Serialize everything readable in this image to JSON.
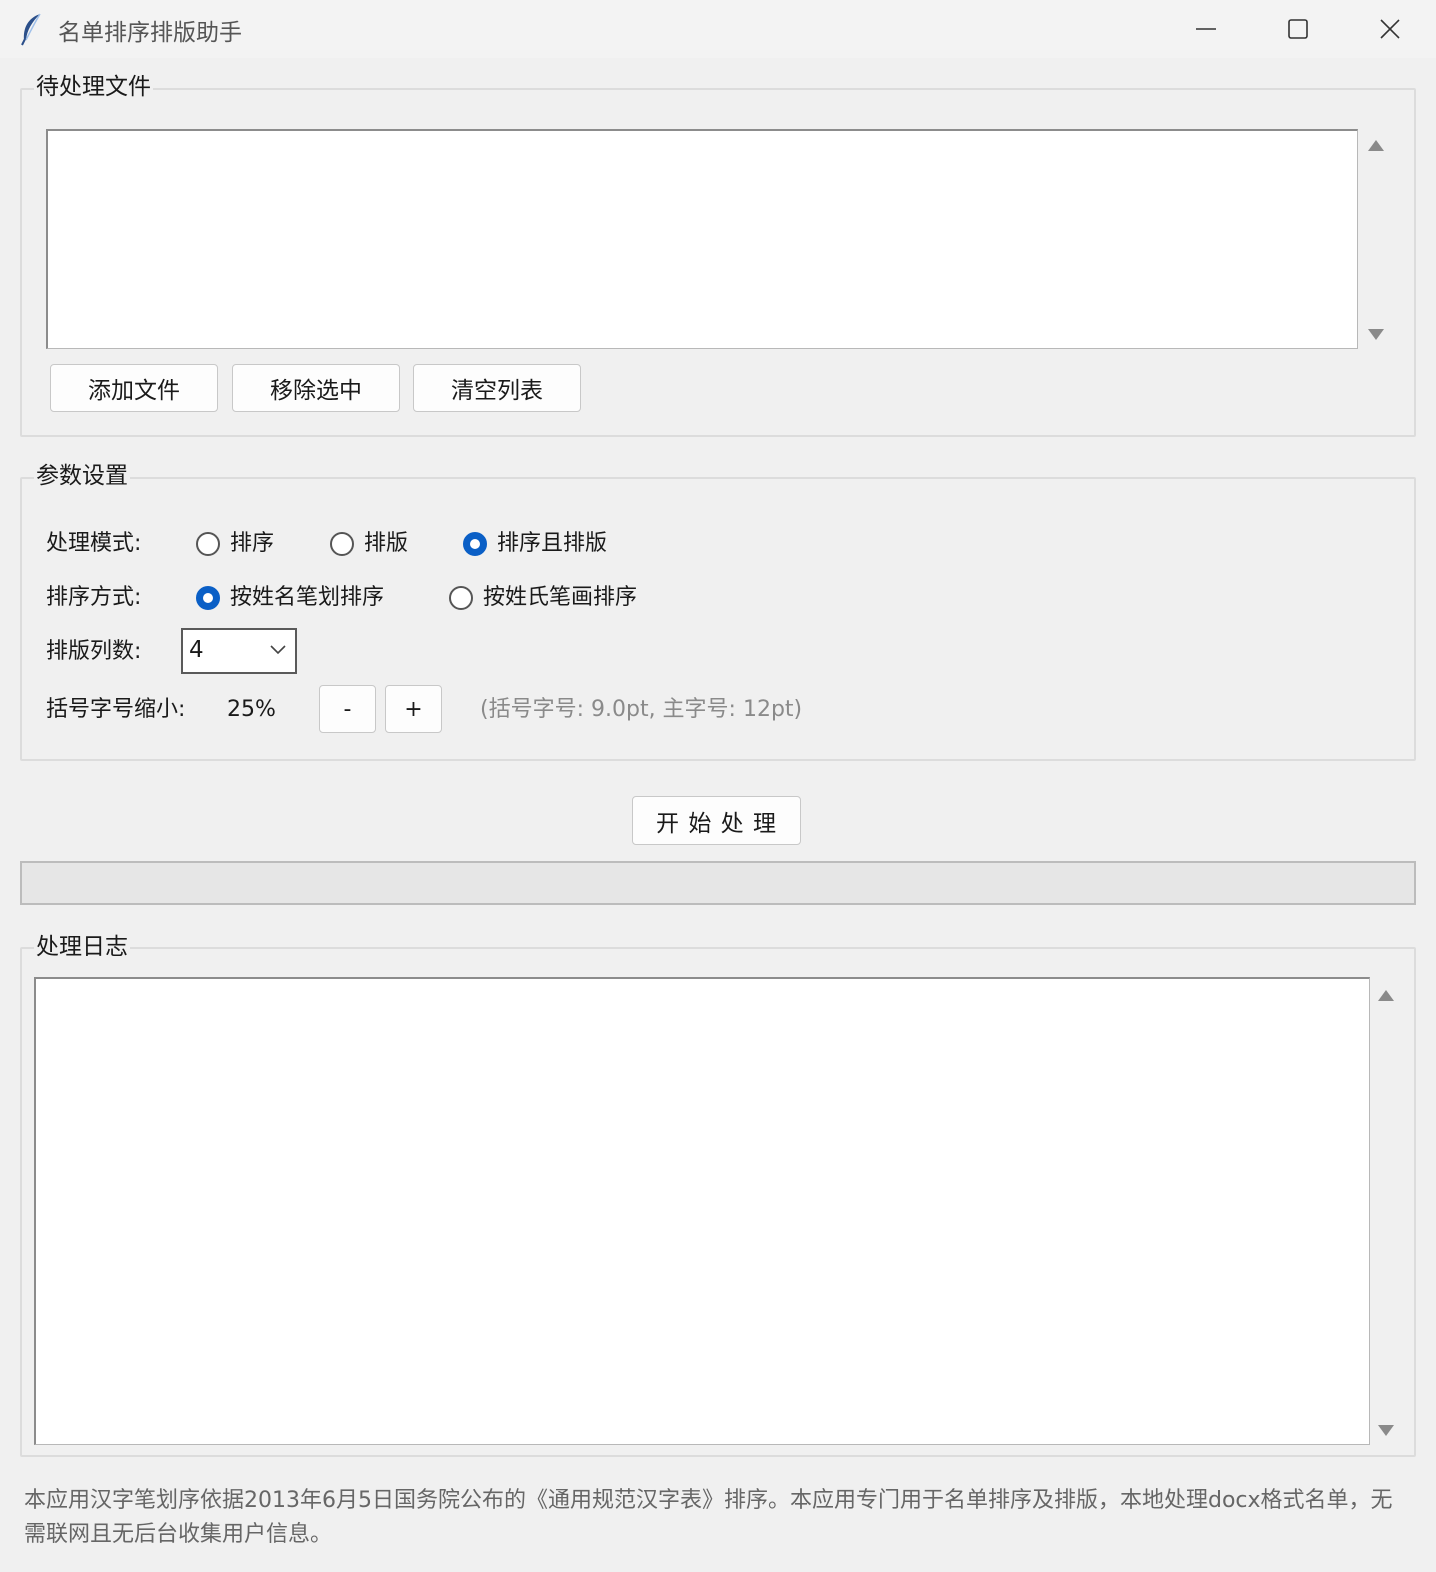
{
  "window": {
    "title": "名单排序排版助手"
  },
  "files_section": {
    "label": "待处理文件",
    "buttons": {
      "add": "添加文件",
      "remove": "移除选中",
      "clear": "清空列表"
    }
  },
  "params_section": {
    "label": "参数设置",
    "mode": {
      "label": "处理模式:",
      "options": [
        "排序",
        "排版",
        "排序且排版"
      ],
      "selected": "排序且排版"
    },
    "sort_method": {
      "label": "排序方式:",
      "options": [
        "按姓名笔划排序",
        "按姓氏笔画排序"
      ],
      "selected": "按姓名笔划排序"
    },
    "columns": {
      "label": "排版列数:",
      "value": "4"
    },
    "bracket_shrink": {
      "label": "括号字号缩小:",
      "value": "25%",
      "minus": "-",
      "plus": "+",
      "hint": "(括号字号: 9.0pt, 主字号: 12pt)"
    }
  },
  "start_button": "开 始 处 理",
  "progress": 0,
  "log_section": {
    "label": "处理日志"
  },
  "footer": "本应用汉字笔划序依据2013年6月5日国务院公布的《通用规范汉字表》排序。本应用专门用于名单排序及排版，本地处理docx格式名单，无需联网且无后台收集用户信息。"
}
